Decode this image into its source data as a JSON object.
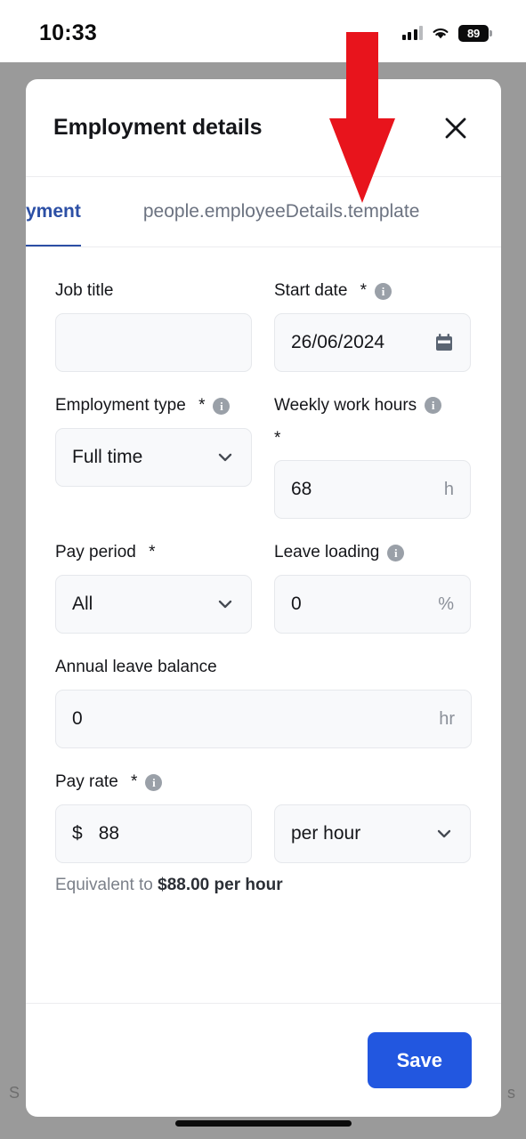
{
  "status_bar": {
    "time": "10:33",
    "battery_percent": "89",
    "signal_icon": "cellular-bars-icon",
    "wifi_icon": "wifi-icon",
    "battery_icon": "battery-icon"
  },
  "background": {
    "left_fragment": "S",
    "right_fragment": "s"
  },
  "annotation": {
    "arrow_icon": "down-arrow-annotation",
    "color": "#E8141C"
  },
  "modal": {
    "title": "Employment details",
    "close_icon": "close-icon",
    "tabs": [
      {
        "label": "yment",
        "active": true
      },
      {
        "label": "people.employeeDetails.template",
        "active": false
      }
    ],
    "fields": {
      "job_title": {
        "label": "Job title",
        "value": "",
        "placeholder": ""
      },
      "start_date": {
        "label": "Start date",
        "required_mark": " *",
        "value": "26/06/2024",
        "info_icon": "info-icon",
        "calendar_icon": "calendar-icon"
      },
      "employment_type": {
        "label": "Employment type",
        "required_mark": " *",
        "value": "Full time",
        "info_icon": "info-icon",
        "chevron_icon": "chevron-down-icon"
      },
      "weekly_work_hours": {
        "label": "Weekly work hours",
        "required_mark": "*",
        "value": "68",
        "unit": "h",
        "info_icon": "info-icon"
      },
      "pay_period": {
        "label": "Pay period",
        "required_mark": " *",
        "value": "All",
        "chevron_icon": "chevron-down-icon"
      },
      "leave_loading": {
        "label": "Leave loading",
        "value": "0",
        "unit": "%",
        "info_icon": "info-icon"
      },
      "annual_leave_balance": {
        "label": "Annual leave balance",
        "value": "0",
        "unit": "hr"
      },
      "pay_rate": {
        "label": "Pay rate",
        "required_mark": " *",
        "currency_symbol": "$",
        "value": "88",
        "info_icon": "info-icon",
        "frequency_value": "per hour",
        "chevron_icon": "chevron-down-icon"
      }
    },
    "equivalent_prefix": "Equivalent to ",
    "equivalent_amount": "$88.00 per hour",
    "save_label": "Save"
  },
  "colors": {
    "accent_blue": "#2257E0",
    "tab_active": "#2C4FA5",
    "backdrop": "#9A9A9A",
    "annotation_red": "#E8141C"
  }
}
